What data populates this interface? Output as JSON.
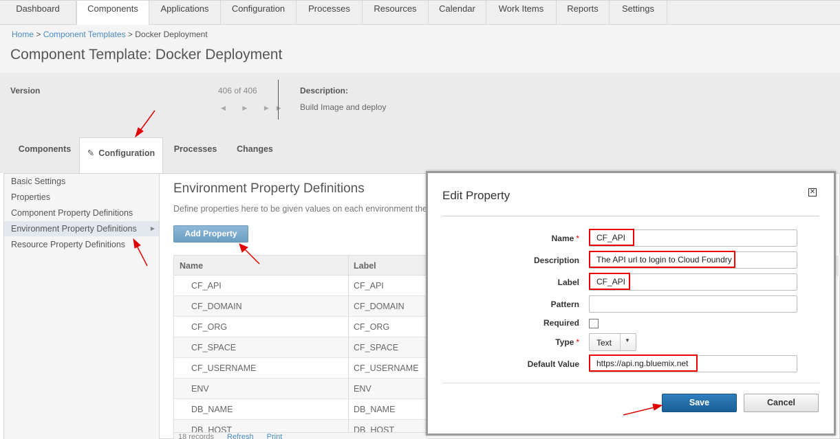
{
  "topnav": {
    "tabs": [
      {
        "label": "Dashboard"
      },
      {
        "label": "Components",
        "active": true
      },
      {
        "label": "Applications"
      },
      {
        "label": "Configuration"
      },
      {
        "label": "Processes"
      },
      {
        "label": "Resources"
      },
      {
        "label": "Calendar"
      },
      {
        "label": "Work Items"
      },
      {
        "label": "Reports"
      },
      {
        "label": "Settings"
      }
    ]
  },
  "breadcrumb": {
    "home": "Home",
    "sep1": ">",
    "templates": "Component Templates",
    "sep2": ">",
    "current": "Docker Deployment"
  },
  "page_title": "Component Template: Docker Deployment",
  "version": {
    "label": "Version",
    "count": "406 of 406",
    "nav": "◀ ▶ ▶▶"
  },
  "description": {
    "label": "Description:",
    "value": "Build Image and deploy"
  },
  "subtabs": [
    {
      "label": "Components"
    },
    {
      "label": "Configuration",
      "active": true
    },
    {
      "label": "Processes"
    },
    {
      "label": "Changes"
    }
  ],
  "pencil_icon": "✎",
  "sidebar": {
    "items": [
      {
        "label": "Basic Settings"
      },
      {
        "label": "Properties"
      },
      {
        "label": "Component Property Definitions"
      },
      {
        "label": "Environment Property Definitions",
        "active": true
      },
      {
        "label": "Resource Property Definitions"
      }
    ],
    "active_arrow": "▶"
  },
  "section": {
    "title": "Environment Property Definitions",
    "description": "Define properties here to be given values on each environment the c",
    "add_button": "Add Property"
  },
  "grid": {
    "headers": {
      "name": "Name",
      "label": "Label"
    },
    "rows": [
      {
        "name": "CF_API",
        "label": "CF_API"
      },
      {
        "name": "CF_DOMAIN",
        "label": "CF_DOMAIN"
      },
      {
        "name": "CF_ORG",
        "label": "CF_ORG"
      },
      {
        "name": "CF_SPACE",
        "label": "CF_SPACE"
      },
      {
        "name": "CF_USERNAME",
        "label": "CF_USERNAME"
      },
      {
        "name": "ENV",
        "label": "ENV"
      },
      {
        "name": "DB_NAME",
        "label": "DB_NAME"
      },
      {
        "name": "DB_HOST",
        "label": "DB_HOST"
      }
    ],
    "footer": {
      "records": "18 records",
      "refresh": "Refresh",
      "print": "Print"
    }
  },
  "dialog": {
    "title": "Edit Property",
    "close_glyph": "✕",
    "fields": {
      "name": {
        "label": "Name",
        "value": "CF_API",
        "required": "*"
      },
      "description": {
        "label": "Description",
        "value": "The API url to login to Cloud Foundry"
      },
      "label": {
        "label": "Label",
        "value": "CF_API"
      },
      "pattern": {
        "label": "Pattern",
        "value": ""
      },
      "required": {
        "label": "Required",
        "checked": false
      },
      "type": {
        "label": "Type",
        "value": "Text",
        "required": "*",
        "arrow": "▼"
      },
      "default_value": {
        "label": "Default Value",
        "value": "https://api.ng.bluemix.net"
      }
    },
    "save_label": "Save",
    "cancel_label": "Cancel"
  },
  "colors": {
    "accent": "#4a8bc2",
    "save_button": "#1f6aa5",
    "highlight": "#e00000",
    "annotation_arrow": "#e00000"
  }
}
